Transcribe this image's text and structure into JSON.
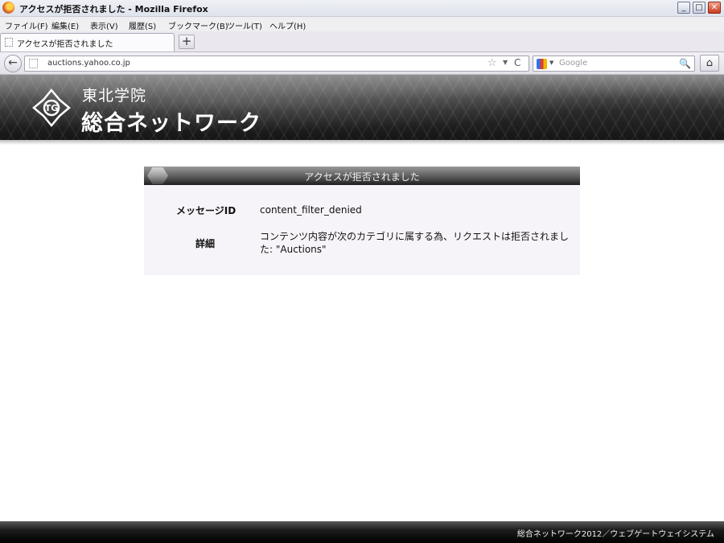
{
  "window": {
    "title": "アクセスが拒否されました - Mozilla Firefox",
    "buttons": {
      "minimize": "_",
      "maximize": "□",
      "close": "✕"
    }
  },
  "menubar": {
    "items": [
      "ファイル(F)",
      "編集(E)",
      "表示(V)",
      "履歴(S)",
      "ブックマーク(B)",
      "ツール(T)",
      "ヘルプ(H)"
    ]
  },
  "tabs": {
    "active_label": "アクセスが拒否されました",
    "new_tab": "+"
  },
  "navbar": {
    "back": "←",
    "url": "auctions.yahoo.co.jp",
    "star": "☆",
    "dropdown": "▼",
    "reload": "C",
    "search_placeholder": "Google",
    "search_icon": "🔍",
    "home": "⌂"
  },
  "banner": {
    "school": "東北学院",
    "network": "総合ネットワーク"
  },
  "message": {
    "title": "アクセスが拒否されました",
    "rows": [
      {
        "label": "メッセージID",
        "value": "content_filter_denied"
      },
      {
        "label": "詳細",
        "value": "コンテンツ内容が次のカテゴリに属する為、リクエストは拒否されました: \"Auctions\""
      }
    ]
  },
  "footer": {
    "text": "総合ネットワーク2012／ウェブゲートウェイシステム"
  },
  "colors": {
    "banner_dark": "#1a1a1a",
    "panel_bg": "#f7f4f9",
    "footer_bg": "#000000"
  },
  "icons": [
    "firefox-logo-icon",
    "back-arrow-icon",
    "page-icon",
    "star-icon",
    "reload-icon",
    "google-icon",
    "search-icon",
    "home-icon",
    "school-emblem-icon"
  ]
}
